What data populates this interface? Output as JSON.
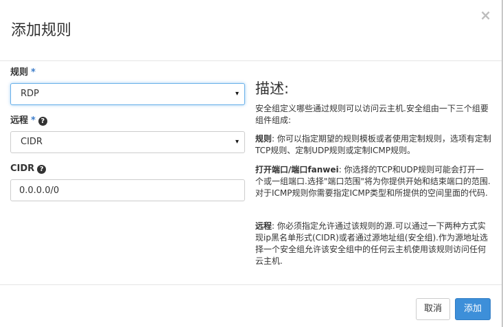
{
  "header": {
    "title": "添加规则",
    "close_symbol": "×"
  },
  "form": {
    "rule": {
      "label": "规则",
      "required_mark": "*",
      "selected": "RDP"
    },
    "remote": {
      "label": "远程",
      "required_mark": "*",
      "selected": "CIDR"
    },
    "cidr": {
      "label": "CIDR",
      "value": "0.0.0.0/0"
    },
    "help_symbol": "?",
    "select_arrow": "▾"
  },
  "description": {
    "title": "描述:",
    "intro": "安全组定义哪些通过规则可以访问云主机.安全组由一下三个组要组件组成:",
    "rule_term": "规则",
    "rule_text": ": 你可以指定期望的规则模板或者使用定制规则，选项有定制TCP规则、定制UDP规则或定制ICMP规则。",
    "port_term": "打开端口/端口fanwei",
    "port_text": ": 你选择的TCP和UDP规则可能会打开一个或一组端口.选择\"端口范围\"将为你提供开始和结束端口的范围.对于ICMP规则你需要指定ICMP类型和所提供的空间里面的代码.",
    "remote_term": "远程",
    "remote_text": ": 你必须指定允许通过该规则的源.可以通过一下两种方式实现ip黑名单形式(CIDR)或者通过源地址组(安全组).作为源地址选择一个安全组允许该安全组中的任何云主机使用该规则访问任何云主机."
  },
  "footer": {
    "cancel_label": "取消",
    "add_label": "添加"
  },
  "colors": {
    "primary": "#3d8fd9",
    "required": "#3c7cc9",
    "focus_border": "#66afe9"
  }
}
